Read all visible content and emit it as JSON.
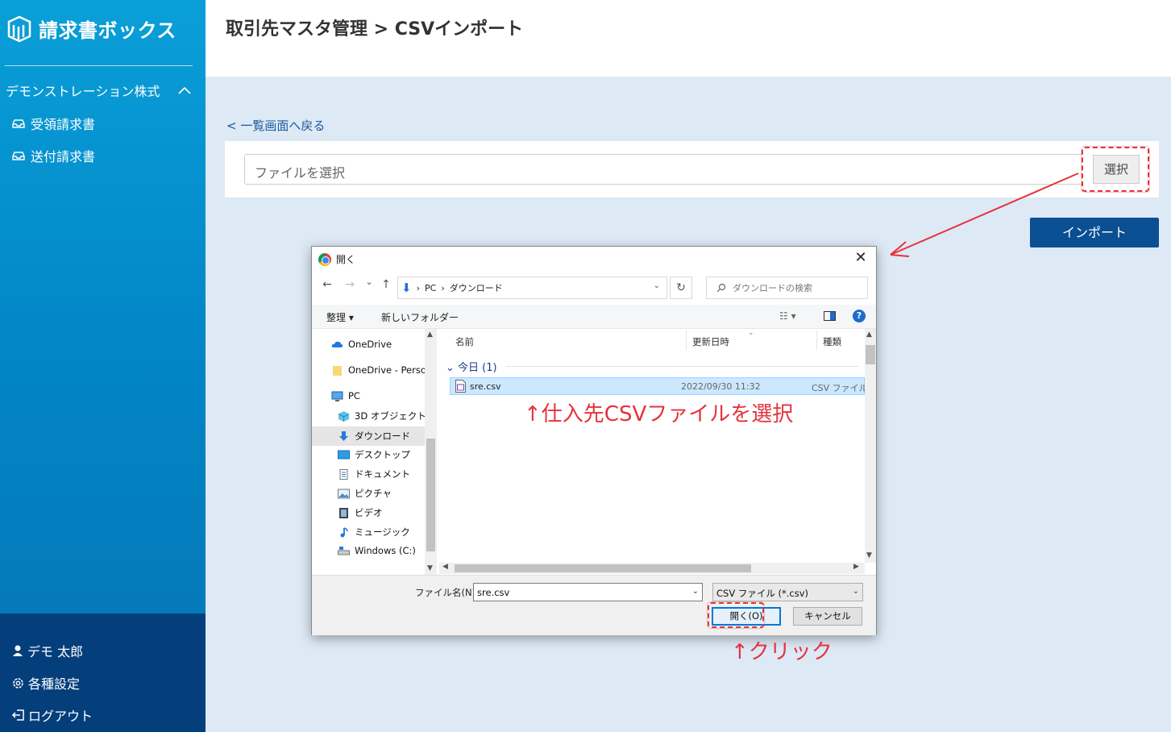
{
  "app": {
    "name": "請求書ボックス",
    "company": "デモンストレーション株式",
    "company_toggle": "^"
  },
  "sidebar": {
    "items": [
      {
        "label": "受領請求書",
        "icon": "inbox-icon"
      },
      {
        "label": "送付請求書",
        "icon": "inbox-icon"
      }
    ],
    "bottom": [
      {
        "label": "デモ 太郎",
        "icon": "user-icon"
      },
      {
        "label": "各種設定",
        "icon": "gear-icon"
      },
      {
        "label": "ログアウト",
        "icon": "logout-icon"
      }
    ]
  },
  "header": {
    "title": "取引先マスタ管理 > CSVインポート"
  },
  "main": {
    "back_link": "< 一覧画面へ戻る",
    "file_placeholder": "ファイルを選択",
    "select_button": "選択",
    "import_button": "インポート"
  },
  "dialog": {
    "title": "開く",
    "close": "✕",
    "nav": {
      "back": "←",
      "forward": "→",
      "recent": "⌄",
      "up": "↑",
      "path": [
        "PC",
        "ダウンロード"
      ],
      "refresh": "↻",
      "search_placeholder": "ダウンロードの検索"
    },
    "toolbar": {
      "organize": "整理",
      "new_folder": "新しいフォルダー",
      "view": "☷",
      "help": "?"
    },
    "tree": [
      {
        "label": "OneDrive",
        "icon": "cloud-icon",
        "level": 0
      },
      {
        "label": "OneDrive - Personal",
        "icon": "folder-icon",
        "level": 0
      },
      {
        "label": "PC",
        "icon": "pc-icon",
        "level": 0
      },
      {
        "label": "3D オブジェクト",
        "icon": "cube-icon",
        "level": 1
      },
      {
        "label": "ダウンロード",
        "icon": "download-icon",
        "level": 1,
        "selected": true
      },
      {
        "label": "デスクトップ",
        "icon": "desktop-icon",
        "level": 1
      },
      {
        "label": "ドキュメント",
        "icon": "document-icon",
        "level": 1
      },
      {
        "label": "ピクチャ",
        "icon": "picture-icon",
        "level": 1
      },
      {
        "label": "ビデオ",
        "icon": "video-icon",
        "level": 1
      },
      {
        "label": "ミュージック",
        "icon": "music-icon",
        "level": 1
      },
      {
        "label": "Windows (C:)",
        "icon": "drive-icon",
        "level": 1
      }
    ],
    "columns": [
      "名前",
      "更新日時",
      "種類"
    ],
    "group": "今日 (1)",
    "files": [
      {
        "name": "sre.csv",
        "modified": "2022/09/30 11:32",
        "type": "CSV ファイル"
      }
    ],
    "filename_label": "ファイル名(N):",
    "filename_value": "sre.csv",
    "filetype_value": "CSV ファイル (*.csv)",
    "open_button": "開く(O)",
    "cancel_button": "キャンセル"
  },
  "annotations": {
    "select_file": "↑仕入先CSVファイルを選択",
    "click": "↑クリック",
    "color": "#e4323c"
  }
}
